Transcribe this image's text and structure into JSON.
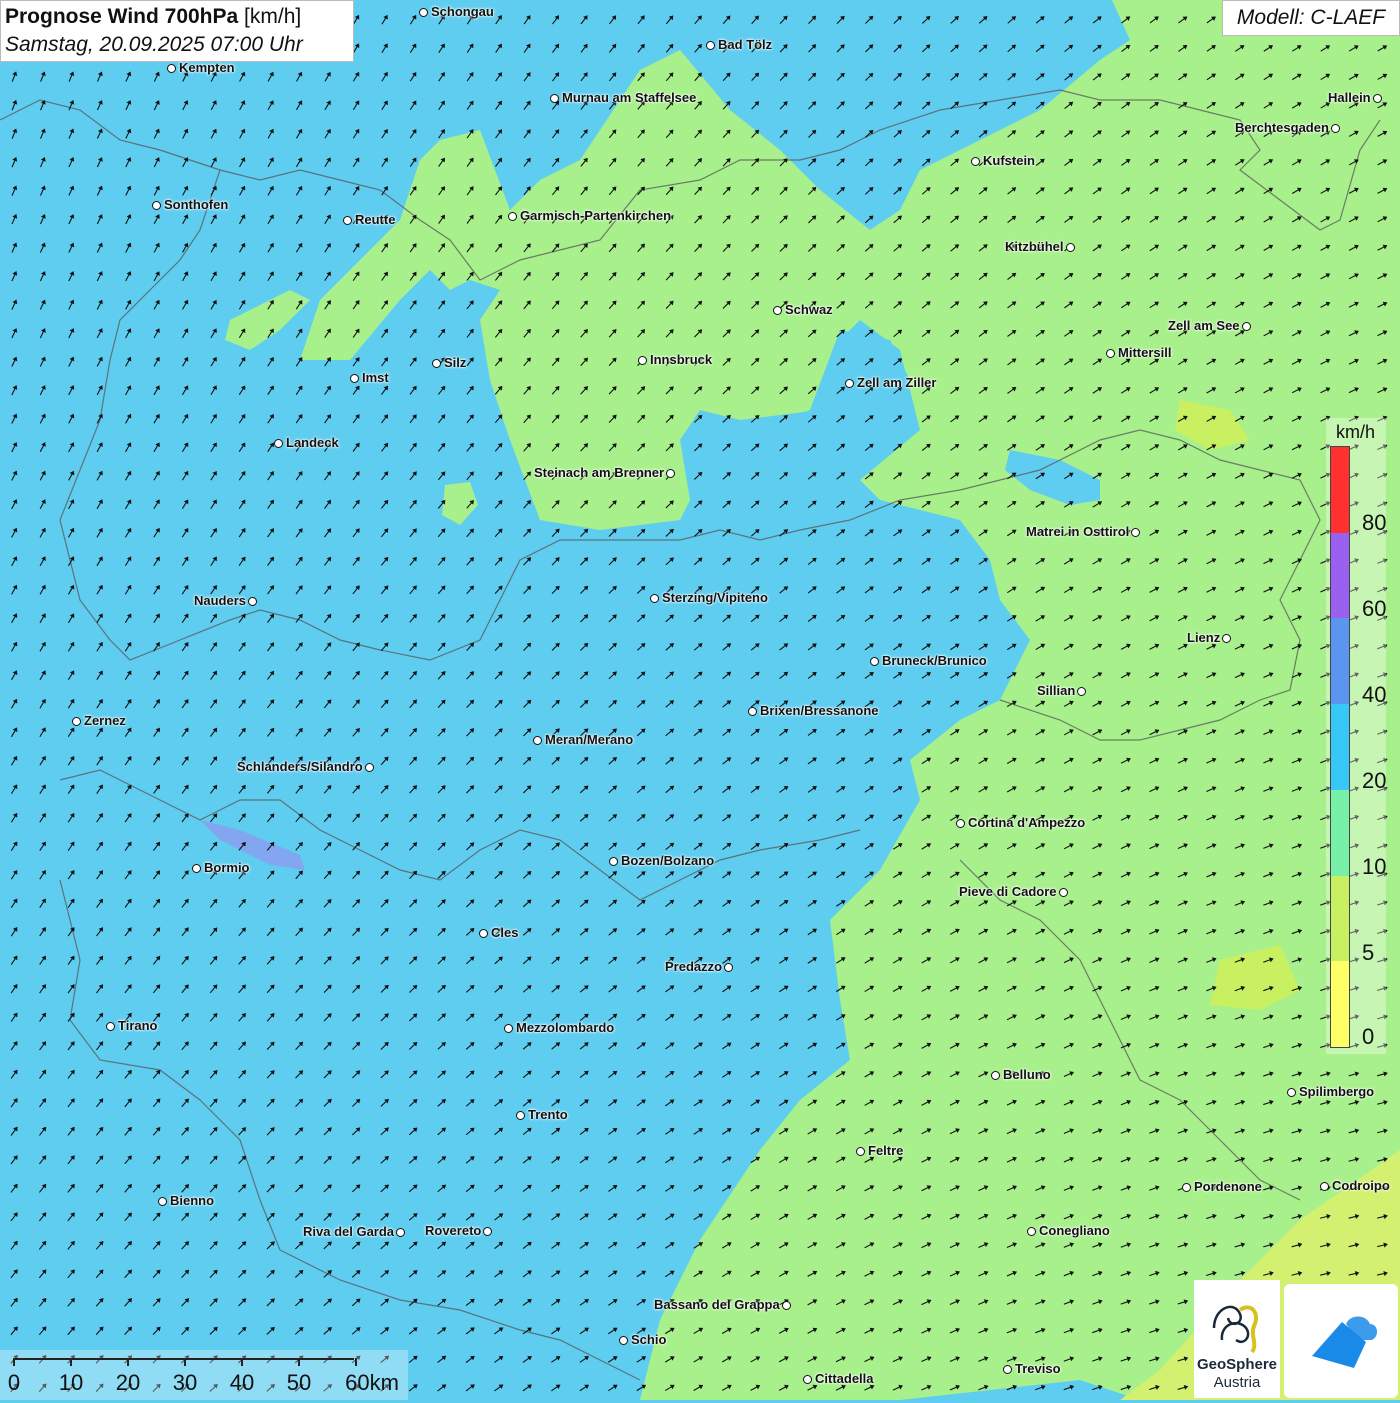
{
  "header": {
    "title_bold": "Prognose Wind 700hPa",
    "title_unit": "[km/h]",
    "datetime": "Samstag, 20.09.2025 07:00 Uhr"
  },
  "model": {
    "label": "Modell: C-LAEF"
  },
  "legend": {
    "unit": "km/h",
    "bands": [
      {
        "from": 0,
        "to": 5,
        "color": "#ffff66"
      },
      {
        "from": 5,
        "to": 10,
        "color": "#c8f060"
      },
      {
        "from": 10,
        "to": 20,
        "color": "#78f0a8"
      },
      {
        "from": 20,
        "to": 40,
        "color": "#38c8f8"
      },
      {
        "from": 40,
        "to": 60,
        "color": "#5a96f0"
      },
      {
        "from": 60,
        "to": 80,
        "color": "#9a60f0"
      },
      {
        "from": 80,
        "to": 100,
        "color": "#ff3030"
      }
    ],
    "ticks": [
      "80",
      "60",
      "40",
      "20",
      "10",
      "5",
      "0"
    ]
  },
  "scale_bar": {
    "labels": [
      "0",
      "10",
      "20",
      "30",
      "40",
      "50",
      "60km"
    ]
  },
  "logo": {
    "org_line1": "GeoSphere",
    "org_line2": "Austria"
  },
  "map_colors": {
    "blue_zone": "#5fcdf0",
    "green_zone": "#a8f08c",
    "yellow_green_zone": "#d4f070"
  },
  "cities": [
    "Schongau",
    "Bad Tölz",
    "Kempten",
    "Murnau am Staffelsee",
    "Hallein",
    "Berchtesgaden",
    "Kufstein",
    "Sonthofen",
    "Reutte",
    "Garmisch-Partenkirchen",
    "Kitzbühel",
    "Schwaz",
    "Zell am See",
    "Mittersill",
    "Imst",
    "Silz",
    "Innsbruck",
    "Zell am Ziller",
    "Landeck",
    "Steinach am Brenner",
    "Matrei in Osttirol",
    "Nauders",
    "Sterzing/Vipiteno",
    "Lienz",
    "Bruneck/Brunico",
    "Sillian",
    "Zernez",
    "Brixen/Bressanone",
    "Meran/Merano",
    "Schlanders/Silandro",
    "Cortina d'Ampezzo",
    "Bozen/Bolzano",
    "Bormio",
    "Pieve di Cadore",
    "Cles",
    "Predazzo",
    "Tirano",
    "Mezzolombardo",
    "Belluno",
    "Spilimbergo",
    "Trento",
    "Feltre",
    "Bienno",
    "Pordenone",
    "Codroipo",
    "Riva del Garda",
    "Rovereto",
    "Conegliano",
    "Bassano del Grappa",
    "Schio",
    "Treviso",
    "Cittadella"
  ]
}
